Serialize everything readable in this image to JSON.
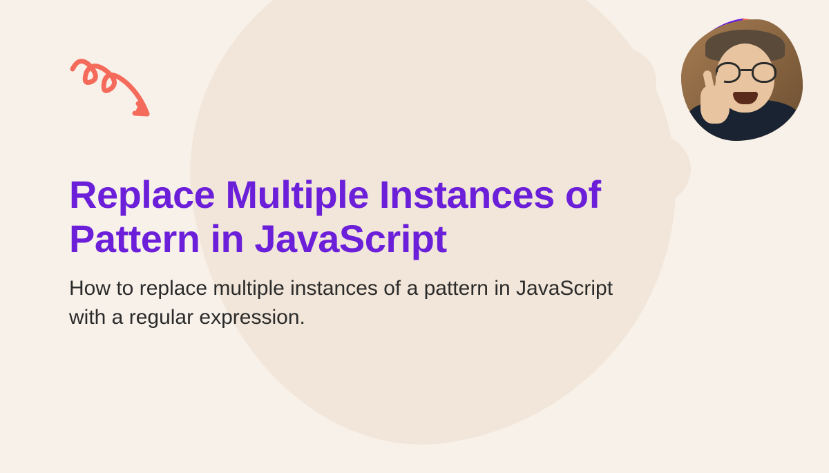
{
  "title": "Replace Multiple Instances of Pattern in JavaScript",
  "subtitle": "How to replace multiple instances of a pattern in JavaScript with a regular expression.",
  "colors": {
    "background": "#F8F1E9",
    "blob": "#F1E6D9",
    "accent_purple": "#6B1FD9",
    "squiggle": "#F56B5B",
    "text": "#2B2B2B"
  },
  "icons": {
    "squiggle": "curly-arrow-icon",
    "avatar": "author-photo"
  }
}
